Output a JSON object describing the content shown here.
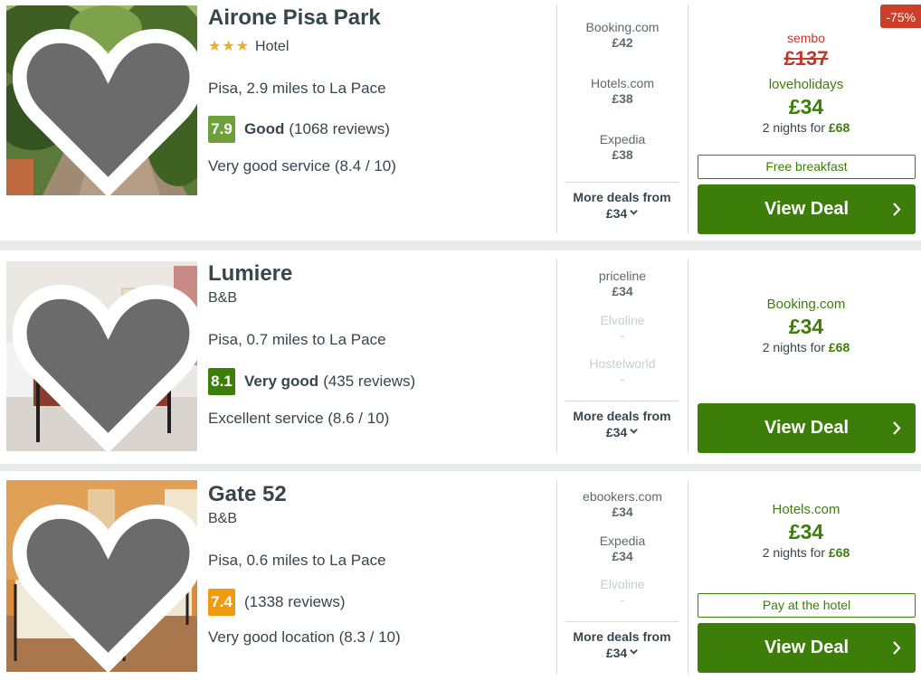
{
  "hotels": [
    {
      "name": "Airone Pisa Park",
      "stars": "★★★",
      "type": "Hotel",
      "location": "Pisa, 2.9 miles to La Pace",
      "score": "7.9",
      "score_color": "#6d9f3a",
      "rating_word": "Good",
      "reviews": "(1068 reviews)",
      "subrating": "Very good service (8.4 / 10)",
      "deals": [
        {
          "site": "Booking.com",
          "price": "£42"
        },
        {
          "site": "Hotels.com",
          "price": "£38"
        },
        {
          "site": "Expedia",
          "price": "£38"
        }
      ],
      "more_label": "More deals from",
      "more_price": "£34",
      "discount": "-75%",
      "orig_source": "sembo",
      "orig_price": "£137",
      "best_provider": "loveholidays",
      "best_price": "£34",
      "nights_text": "2 nights for",
      "nights_price": "£68",
      "perk": "Free breakfast",
      "cta": "View Deal"
    },
    {
      "name": "Lumiere",
      "type": "B&B",
      "location": "Pisa, 0.7 miles to La Pace",
      "score": "8.1",
      "score_color": "#3d7e0a",
      "rating_word": "Very good",
      "reviews": "(435 reviews)",
      "subrating": "Excellent service (8.6 / 10)",
      "deals": [
        {
          "site": "priceline",
          "price": "£34"
        },
        {
          "site": "Elvoline",
          "price": "-"
        },
        {
          "site": "Hostelworld",
          "price": "-"
        }
      ],
      "more_label": "More deals from",
      "more_price": "£34",
      "best_provider": "Booking.com",
      "best_price": "£34",
      "nights_text": "2 nights for",
      "nights_price": "£68",
      "cta": "View Deal"
    },
    {
      "name": "Gate 52",
      "type": "B&B",
      "location": "Pisa, 0.6 miles to La Pace",
      "score": "7.4",
      "score_color": "#f09a0d",
      "reviews": "(1338 reviews)",
      "subrating": "Very good location (8.3 / 10)",
      "deals": [
        {
          "site": "ebookers.com",
          "price": "£34"
        },
        {
          "site": "Expedia",
          "price": "£34"
        },
        {
          "site": "Elvoline",
          "price": "-"
        }
      ],
      "more_label": "More deals from",
      "more_price": "£34",
      "best_provider": "Hotels.com",
      "best_price": "£34",
      "nights_text": "2 nights for",
      "nights_price": "£68",
      "perk": "Pay at the hotel",
      "cta": "View Deal"
    }
  ],
  "icons": {
    "favorite": "heart-icon",
    "expand": "chevron-down-icon",
    "cta_arrow": "chevron-right-icon"
  }
}
